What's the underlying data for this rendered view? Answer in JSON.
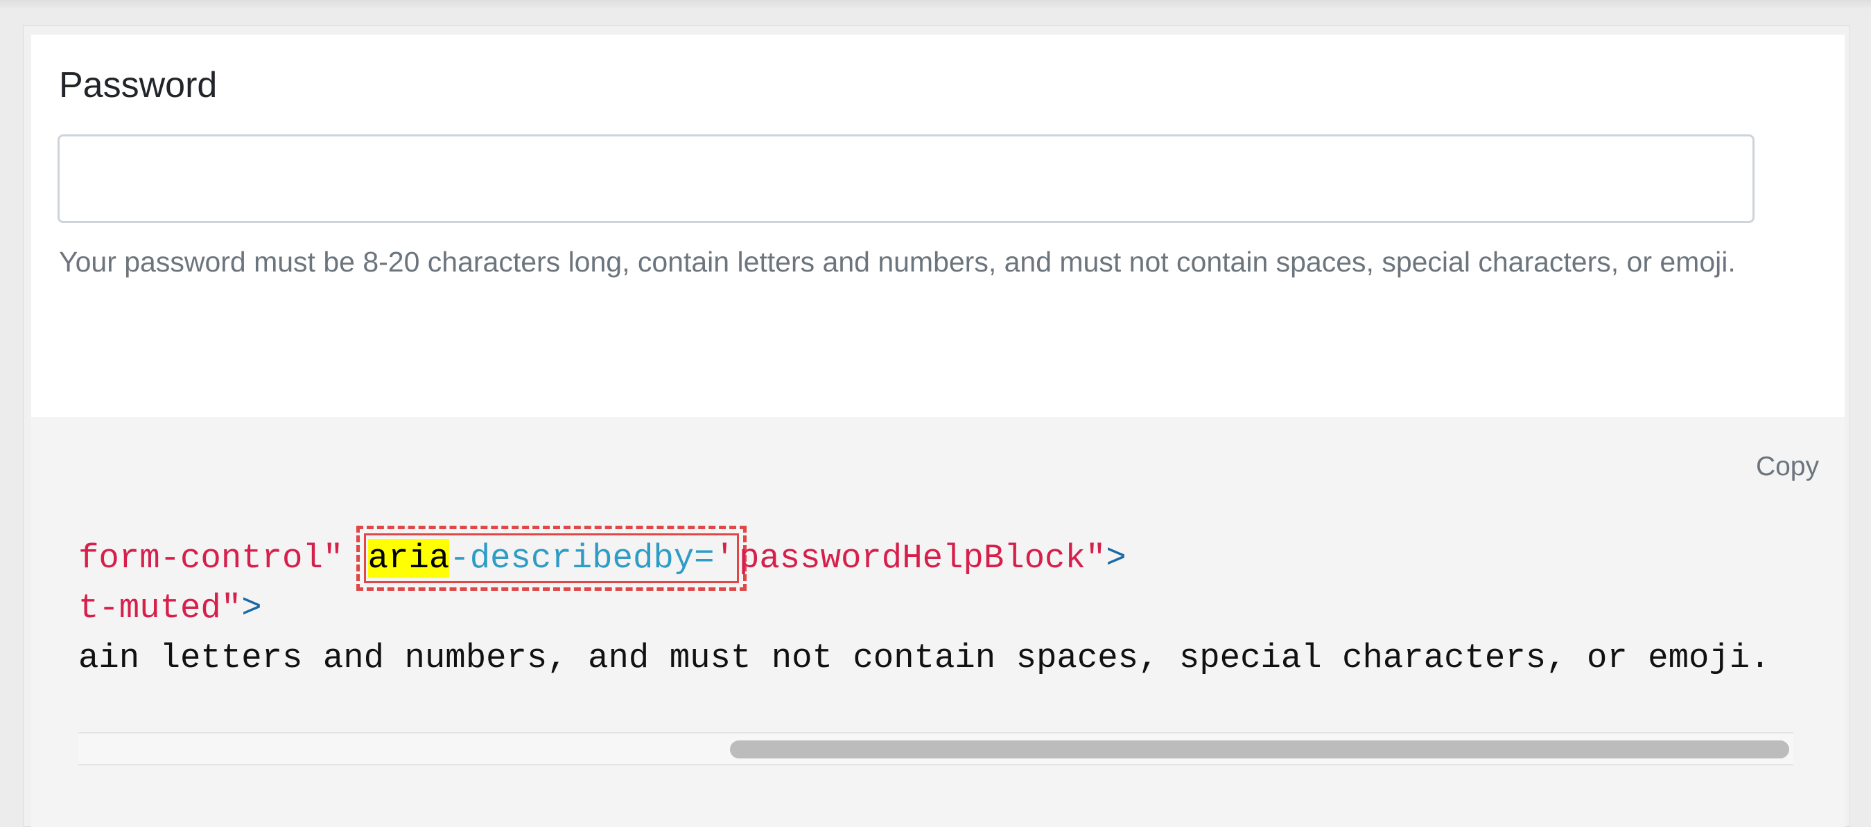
{
  "form": {
    "label": "Password",
    "input_value": "",
    "help_text": "Your password must be 8-20 characters long, contain letters and numbers, and must not contain spaces, special characters, or emoji."
  },
  "code_block": {
    "copy_label": "Copy",
    "line1": {
      "str_part": "form-control\"",
      "highlighted_attr": "aria",
      "attr_rest": "-describedby=",
      "quote": "'",
      "value": "passwordHelpBlock\"",
      "close": ">"
    },
    "line2": {
      "str_part": "t-muted\"",
      "close": ">"
    },
    "line3": {
      "text": "ain letters and numbers, and must not contain spaces, special characters, or emoji."
    },
    "scrollbar": {
      "thumb_start_fraction": 0.38,
      "thumb_end_fraction": 1.0
    }
  },
  "colors": {
    "string": "#d6204c",
    "attribute": "#2f9cc6",
    "punctuation": "#1b6aa5",
    "highlight": "#ffff00",
    "annotation_box": "#e04848"
  }
}
